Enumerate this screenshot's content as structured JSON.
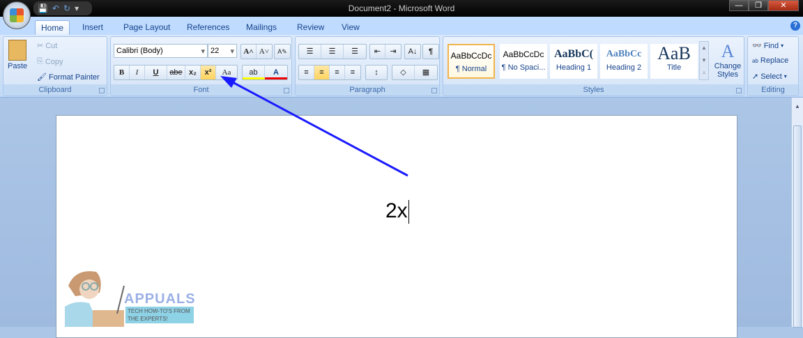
{
  "window": {
    "title": "Document2 - Microsoft Word",
    "minimize": "—",
    "restore": "❐",
    "close": "✕"
  },
  "qat": {
    "save": "💾",
    "undo": "↶",
    "redo": "↻",
    "customize": "▾"
  },
  "tabs": [
    "Home",
    "Insert",
    "Page Layout",
    "References",
    "Mailings",
    "Review",
    "View"
  ],
  "help": "?",
  "clipboard": {
    "label": "Clipboard",
    "paste": "Paste",
    "cut": "Cut",
    "copy": "Copy",
    "format_painter": "Format Painter"
  },
  "font": {
    "label": "Font",
    "name": "Calibri (Body)",
    "size": "22",
    "grow": "A˄",
    "shrink": "A˅",
    "clear": "A✎",
    "bold": "B",
    "italic": "I",
    "underline": "U",
    "strike": "abe",
    "subscript": "x₂",
    "superscript": "x²",
    "case": "Aa",
    "highlight": "ab",
    "color": "A"
  },
  "paragraph": {
    "label": "Paragraph",
    "bullets": "☰",
    "numbering": "☰",
    "multilevel": "☰",
    "dec_indent": "⇤",
    "inc_indent": "⇥",
    "sort": "A↓",
    "pilcrow": "¶",
    "align_left": "≡",
    "center": "≡",
    "align_right": "≡",
    "justify": "≡",
    "line_spacing": "↕",
    "shading": "◇",
    "borders": "▦"
  },
  "styles": {
    "label": "Styles",
    "items": [
      {
        "preview": "AaBbCcDc",
        "name": "¶ Normal"
      },
      {
        "preview": "AaBbCcDc",
        "name": "¶ No Spaci..."
      },
      {
        "preview": "AaBbC(",
        "name": "Heading 1"
      },
      {
        "preview": "AaBbCc",
        "name": "Heading 2"
      },
      {
        "preview": "AaB",
        "name": "Title"
      }
    ],
    "change_styles": "Change Styles"
  },
  "editing": {
    "label": "Editing",
    "find": "Find",
    "replace": "Replace",
    "select": "Select"
  },
  "document": {
    "text": "2x"
  },
  "watermark": {
    "brand": "APPUALS",
    "tagline": "TECH HOW-TO'S FROM THE EXPERTS!"
  },
  "colors": {
    "accent": "#15428b",
    "annotation_arrow": "#1a1aff"
  }
}
